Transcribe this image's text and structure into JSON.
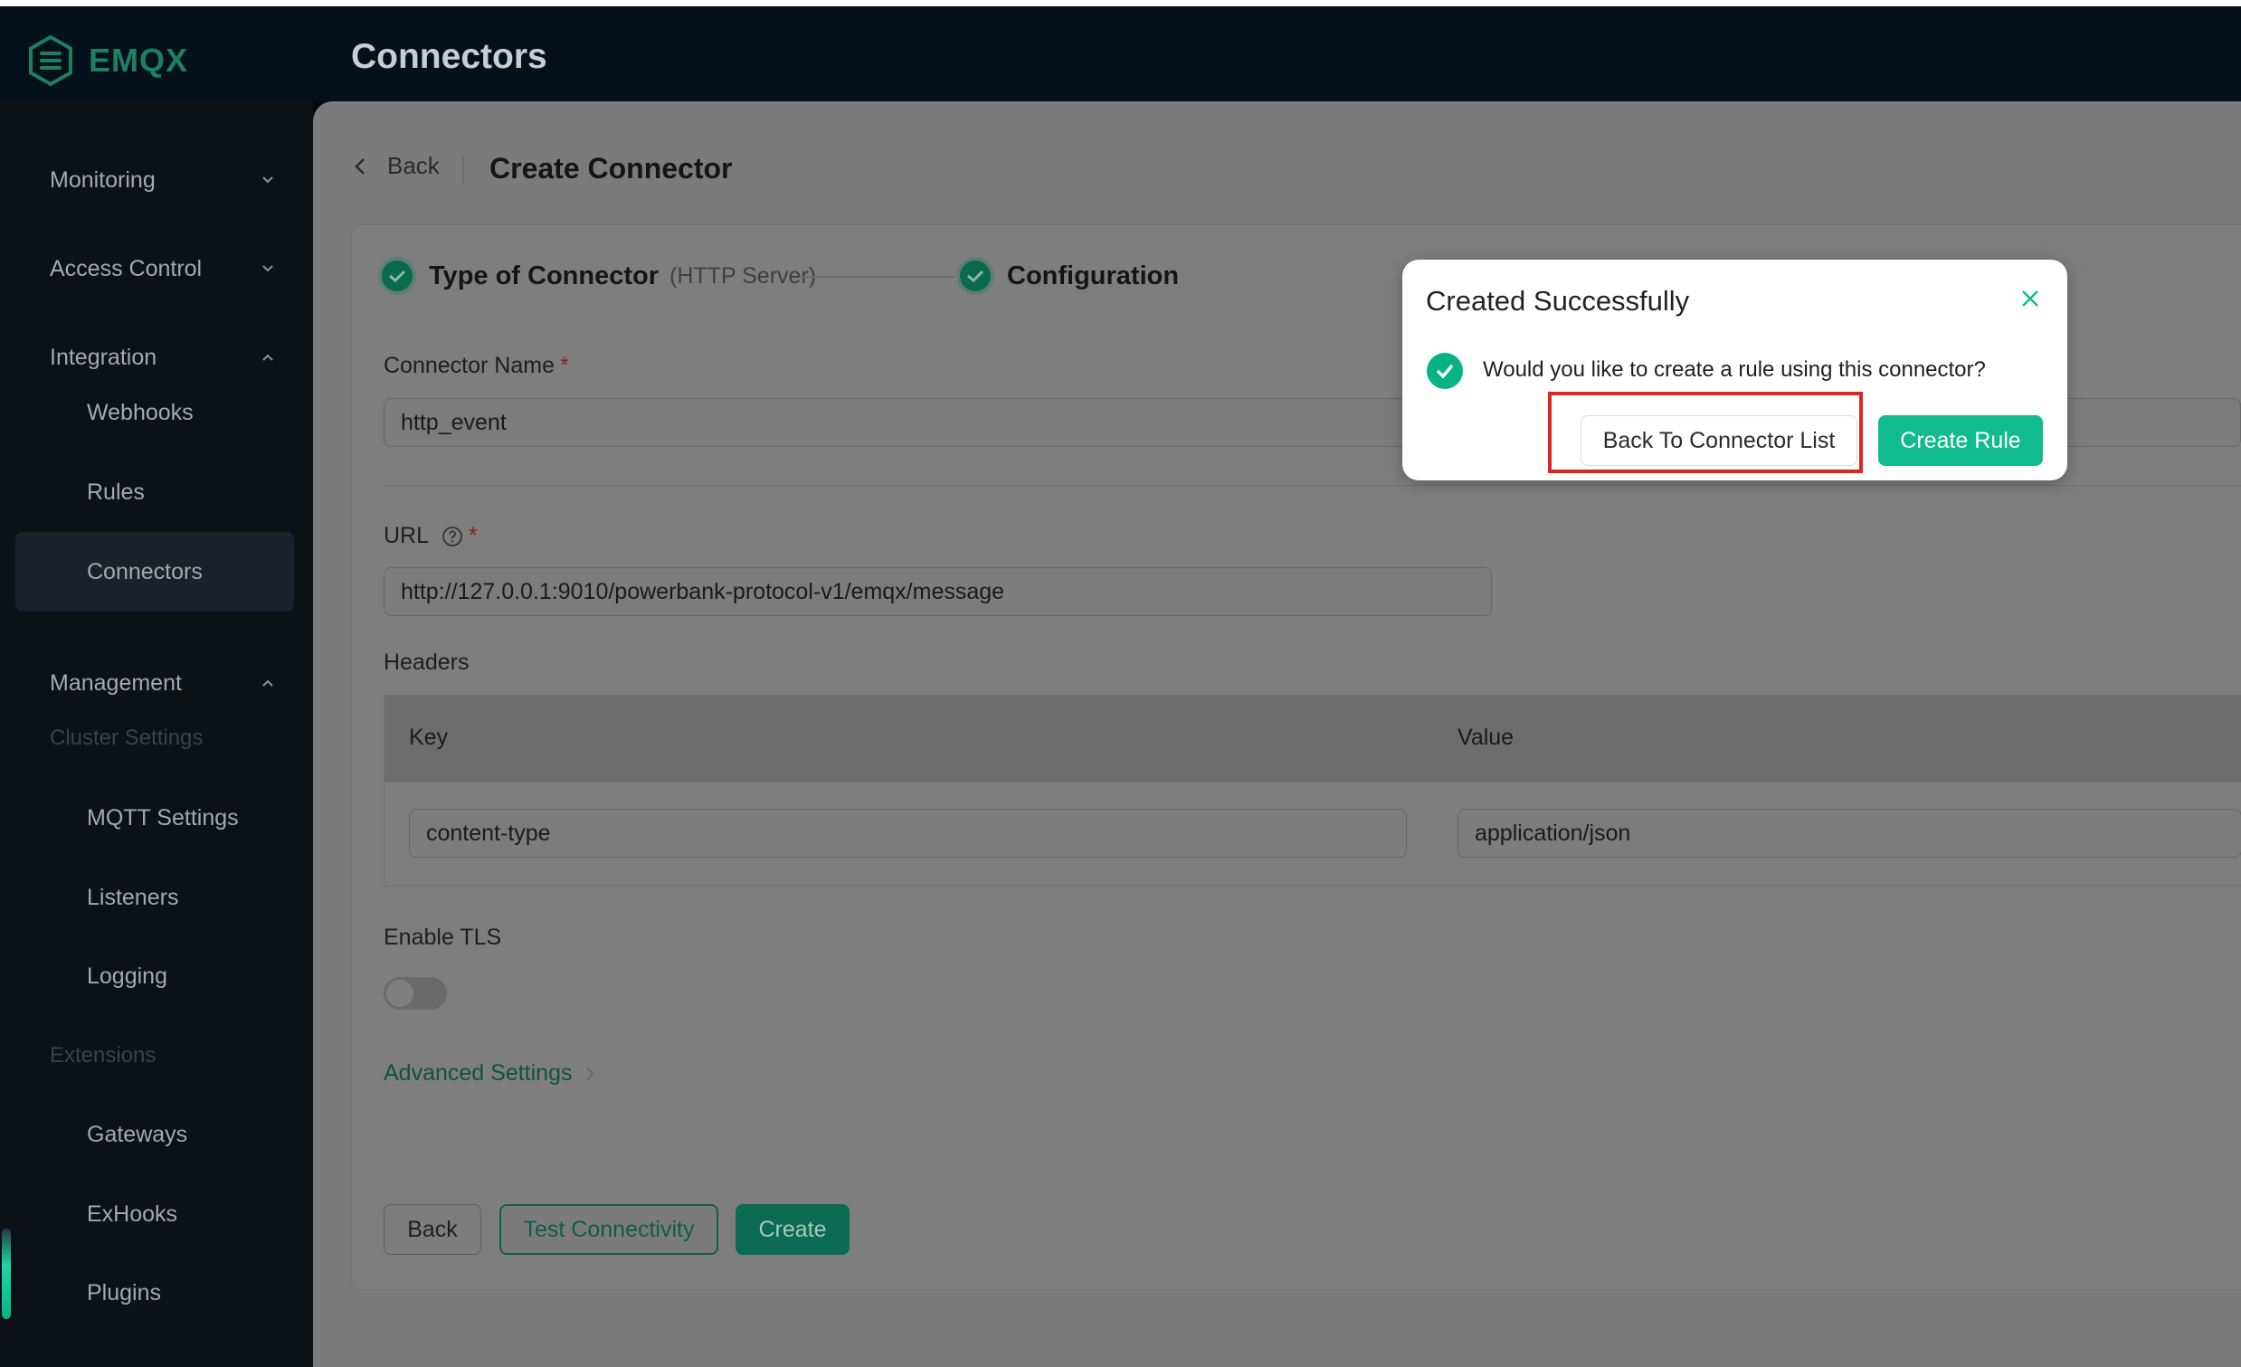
{
  "app": {
    "name": "EMQX",
    "brand_color": "#1e7f63",
    "page_title": "Connectors"
  },
  "sidebar": {
    "groups": [
      {
        "label": "Monitoring",
        "expanded": false
      },
      {
        "label": "Access Control",
        "expanded": false
      },
      {
        "label": "Integration",
        "expanded": true
      },
      {
        "label": "Management",
        "expanded": true
      }
    ],
    "integration_items": [
      "Webhooks",
      "Rules",
      "Connectors"
    ],
    "active_item": "Connectors",
    "section_cluster": "Cluster Settings",
    "cluster_items": [
      "MQTT Settings",
      "Listeners",
      "Logging"
    ],
    "section_extensions": "Extensions",
    "extension_items": [
      "Gateways",
      "ExHooks",
      "Plugins"
    ]
  },
  "breadcrumb": {
    "back": "Back",
    "title": "Create Connector"
  },
  "steps": [
    {
      "title": "Type of Connector",
      "sub": "(HTTP Server)",
      "done": true
    },
    {
      "title": "Configuration",
      "done": true
    }
  ],
  "form": {
    "connector_name_label": "Connector Name",
    "connector_name_value": "http_event",
    "required_mark": "*",
    "url_label": "URL",
    "url_value": "http://127.0.0.1:9010/powerbank-protocol-v1/emqx/message",
    "headers_label": "Headers",
    "headers_columns": [
      "Key",
      "Value"
    ],
    "headers_rows": [
      {
        "key": "content-type",
        "value": "application/json"
      }
    ],
    "tls_label": "Enable TLS",
    "tls_enabled": false,
    "advanced_settings": "Advanced Settings"
  },
  "actions": {
    "back": "Back",
    "test": "Test Connectivity",
    "create": "Create"
  },
  "dialog": {
    "title": "Created Successfully",
    "message": "Would you like to create a rule using this connector?",
    "secondary_button": "Back To Connector List",
    "primary_button": "Create Rule",
    "accent_color": "#10bb8e"
  },
  "highlight_color": "#e2251f"
}
